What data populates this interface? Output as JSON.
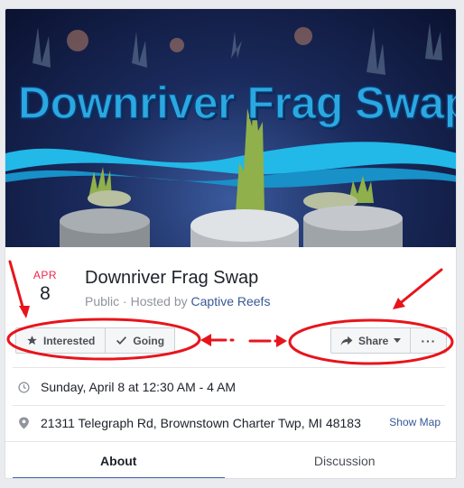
{
  "cover": {
    "title": "Downriver Frag Swap"
  },
  "event": {
    "month": "APR",
    "day": "8",
    "title": "Downriver Frag Swap",
    "privacy": "Public",
    "hosted_by_prefix": " · Hosted by ",
    "host": "Captive Reefs"
  },
  "actions": {
    "interested_label": "Interested",
    "going_label": "Going",
    "share_label": "Share",
    "more_label": "···"
  },
  "details": {
    "datetime": "Sunday, April 8 at 12:30 AM - 4 AM",
    "address": "21311 Telegraph Rd, Brownstown Charter Twp, MI 48183",
    "show_map_label": "Show Map"
  },
  "tabs": [
    {
      "label": "About",
      "active": true
    },
    {
      "label": "Discussion",
      "active": false
    }
  ],
  "colors": {
    "accent": "#4267b2",
    "link": "#385898",
    "month": "#f02849",
    "annotation": "#e8141b"
  }
}
